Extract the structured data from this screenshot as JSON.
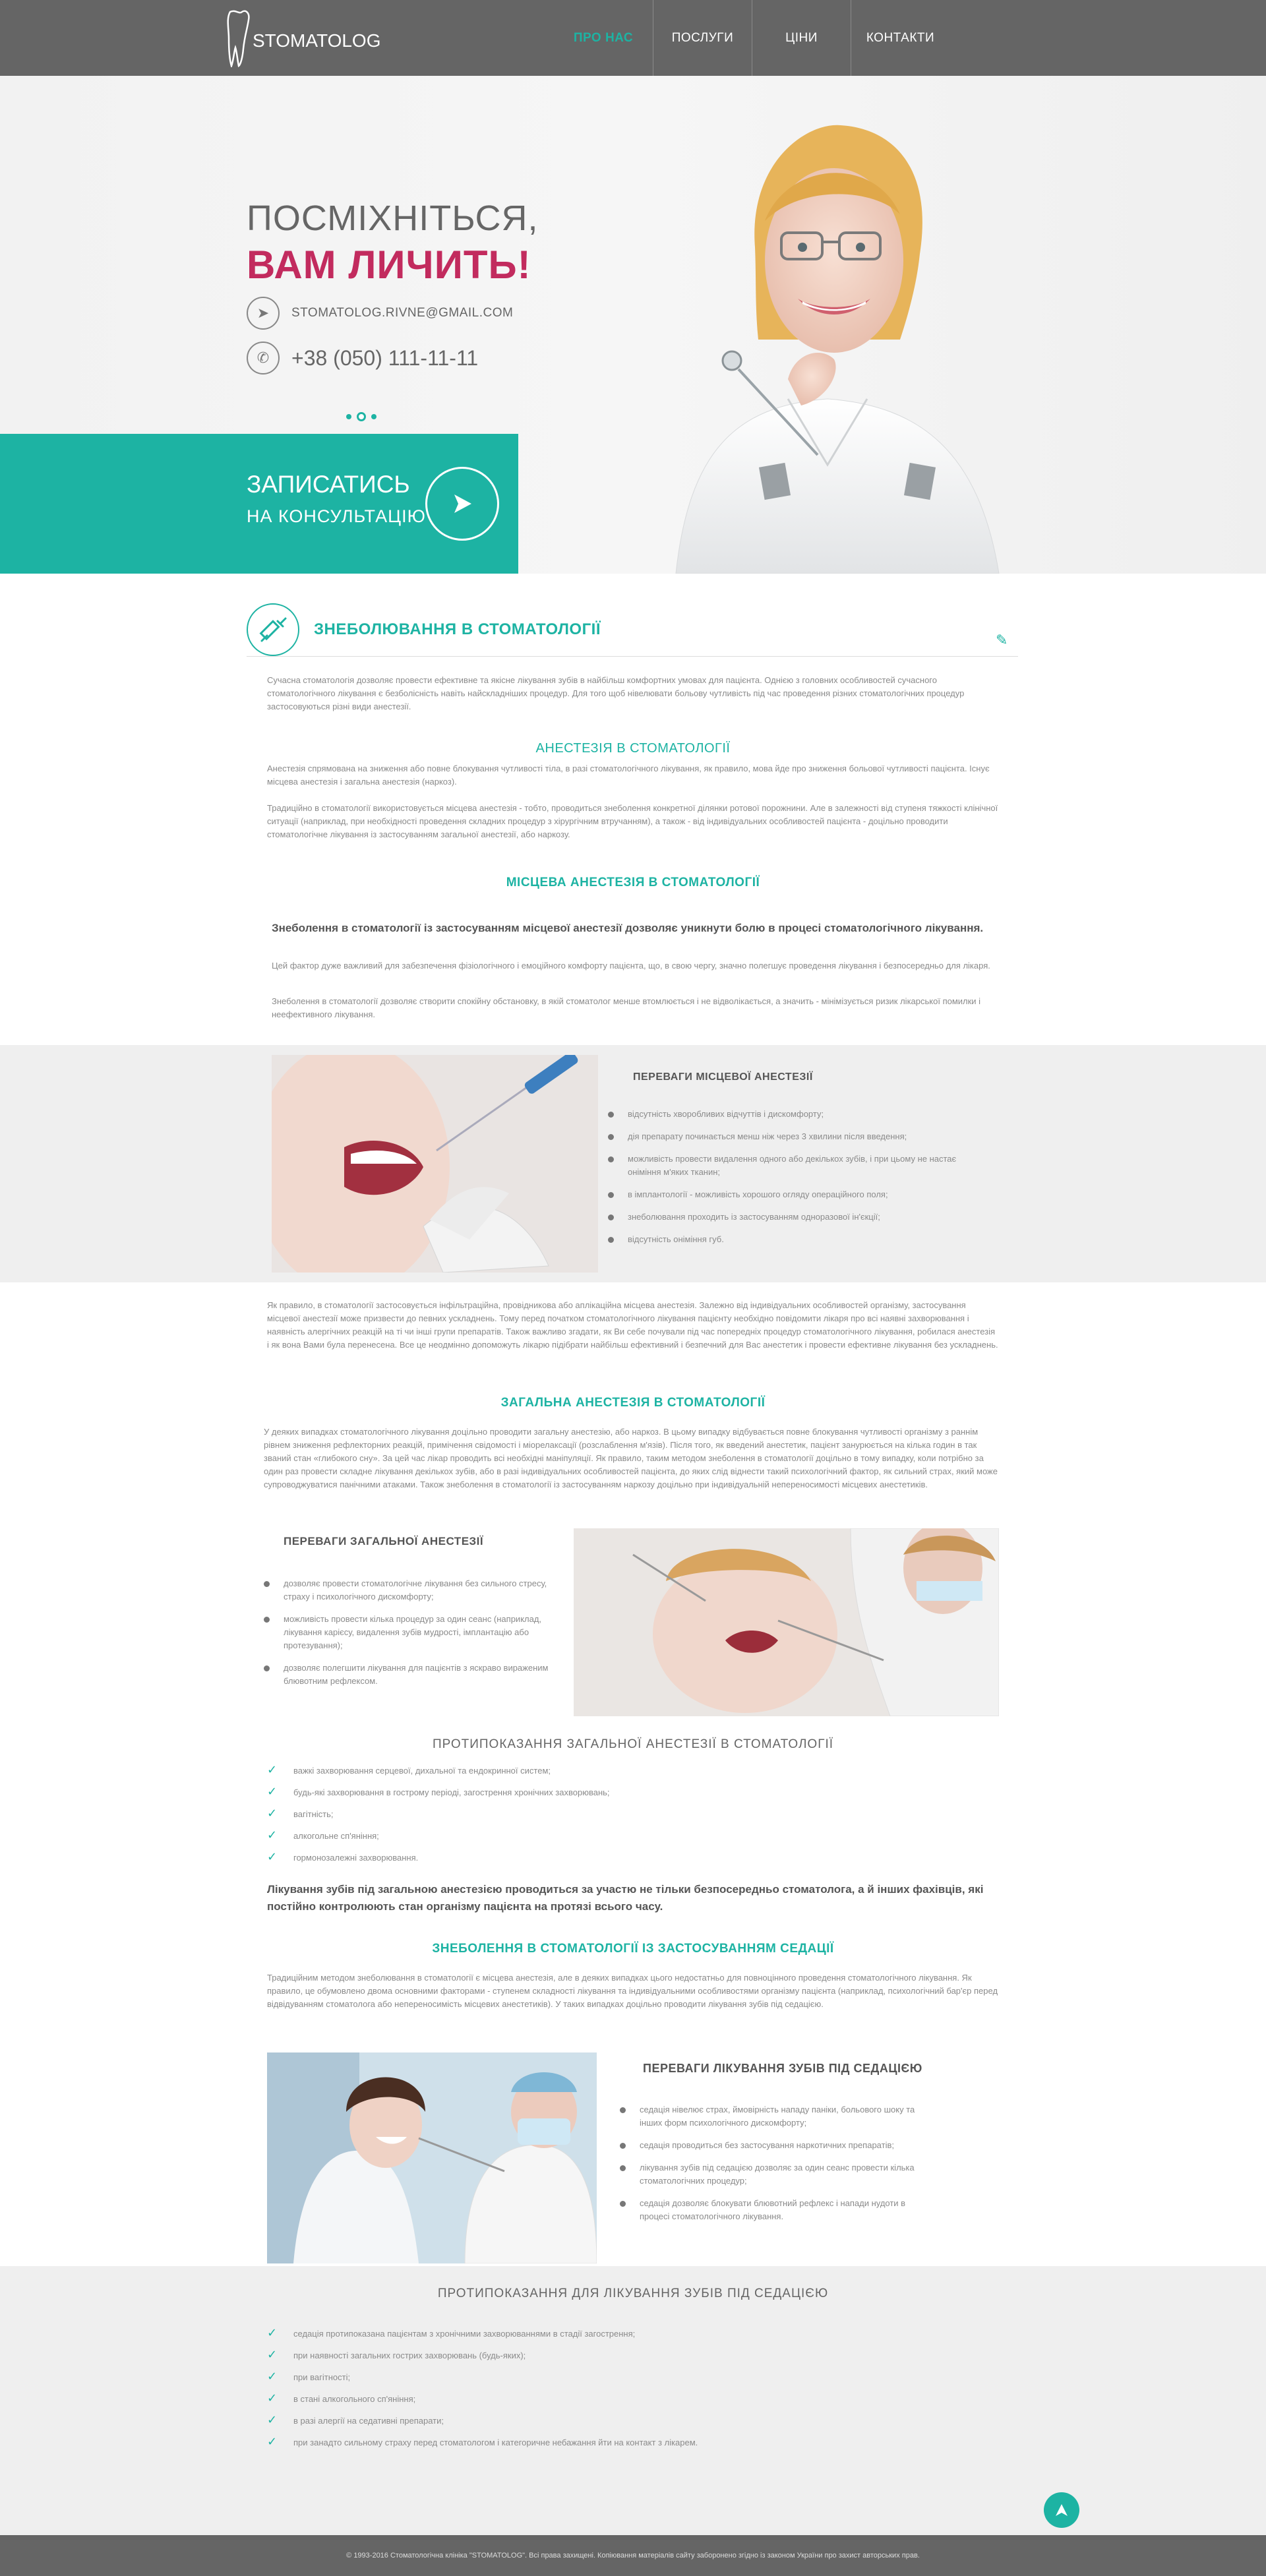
{
  "brand": {
    "name": "STOMATOLOG"
  },
  "nav": [
    {
      "label": "ПРО НАС"
    },
    {
      "label": "ПОСЛУГИ"
    },
    {
      "label": "ЦІНИ"
    },
    {
      "label": "КОНТАКТИ"
    }
  ],
  "hero": {
    "title1": "ПОСМІХНІТЬСЯ,",
    "title2": "ВАМ ЛИЧИТЬ!",
    "email": "STOMATOLOG.RIVNE@GMAIL.COM",
    "phone": "+38 (050) 111-11-11",
    "cta_line1": "ЗАПИСАТИСЬ",
    "cta_line2": "НА КОНСУЛЬТАЦІЮ",
    "slides": 3,
    "active_slide": 2
  },
  "section1": {
    "title": "ЗНЕБОЛЮВАННЯ В СТОМАТОЛОГІЇ",
    "intro": "Сучасна стоматологія дозволяє провести ефективне та якісне лікування зубів в найбільш комфортних умовах для пацієнта. Однією з головних особливостей сучасного стоматологічного лікування є безболісність навіть найскладніших процедур. Для того щоб нівелювати больову чутливість під час проведення різних стоматологічних процедур застосовуються різні види анестезії.",
    "h_anest": "АНЕСТЕЗІЯ В СТОМАТОЛОГІЇ",
    "anest_p1": "Анестезія спрямована на зниження або повне блокування чутливості тіла, в разі стоматологічного лікування, як правило, мова йде про зниження больової чутливості пацієнта. Існує місцева анестезія і загальна анестезія (наркоз).",
    "anest_p2": "Традиційно в стоматології використовується місцева анестезія - тобто, проводиться знеболення конкретної ділянки ротової порожнини. Але в залежності від ступеня тяжкості клінічної ситуації (наприклад, при необхідності проведення складних процедур з хірургічним втручанням), а також - від індивідуальних особливостей пацієнта - доцільно проводити стоматологічне лікування із застосуванням загальної анестезії, або наркозу.",
    "h_local": "МІСЦЕВА АНЕСТЕЗІЯ В СТОМАТОЛОГІЇ",
    "local_lead": "Знеболення в стоматології із застосуванням місцевої анестезії дозволяє уникнути болю в процесі стоматологічного лікування.",
    "local_p1": "Цей фактор дуже важливий для забезпечення фізіологічного і емоційного комфорту пацієнта, що, в свою чергу, значно полегшує проведення лікування і безпосередньо для лікаря.",
    "local_p2": "Знеболення в стоматології дозволяє створити спокійну обстановку, в якій стоматолог менше втомлюється і не відволікається, а значить - мінімізується ризик лікарської помилки і неефективного лікування."
  },
  "local_benefits": {
    "title": "ПЕРЕВАГИ МІСЦЕВОЇ АНЕСТЕЗІЇ",
    "items": [
      "відсутність хворобливих відчуттів і дискомфорту;",
      "дія препарату починається менш ніж через 3 хвилини після введення;",
      "можливість провести видалення одного або декількох зубів, і при цьому не настає оніміння м'яких тканин;",
      "в імплантології - можливість хорошого огляду операційного поля;",
      "знеболювання проходить із застосуванням одноразової ін'єкції;",
      "відсутність оніміння губ."
    ]
  },
  "section2": {
    "p_infiltr": "Як правило, в стоматології застосовується інфільтраційна, провідникова або аплікаційна місцева анестезія. Залежно від індивідуальних особливостей організму, застосування місцевої анестезії може призвести до певних ускладнень. Тому перед початком стоматологічного лікування пацієнту необхідно повідомити лікаря про всі наявні захворювання і наявність алергічних реакцій на ті чи інші групи препаратів. Також важливо згадати, як Ви себе почували під час попередніх процедур стоматологічного лікування, робилася анестезія і як вона Вами була перенесена. Все це неодмінно допоможуть лікарю підібрати найбільш ефективний і безпечний для Вас анестетик і провести ефективне лікування без ускладнень.",
    "h_general": "ЗАГАЛЬНА АНЕСТЕЗІЯ В СТОМАТОЛОГІЇ",
    "p_general": "У деяких випадках стоматологічного лікування доцільно проводити загальну анестезію, або наркоз. В цьому випадку відбувається повне блокування чутливості організму з раннім рівнем зниження рефлекторних реакцій, примічення свідомості і міорелаксації (розслаблення м'язів). Після того, як введений анестетик, пацієнт занурюється на кілька годин в так званий стан «глибокого сну». За цей час лікар проводить всі необхідні маніпуляції. Як правило, таким методом знеболення в стоматології доцільно в тому випадку, коли потрібно за один раз провести складне лікування декількох зубів, або в разі індивідуальних особливостей пацієнта, до яких слід віднести такий психологічний фактор, як сильний страх, який може супроводжуватися панічними атаками. Також знеболення в стоматології із застосуванням наркозу доцільно при індивідуальній непереносимості місцевих анестетиків."
  },
  "general_benefits": {
    "title": "ПЕРЕВАГИ ЗАГАЛЬНОЇ АНЕСТЕЗІЇ",
    "items": [
      "дозволяє провести стоматологічне лікування без сильного стресу, страху і психологічного дискомфорту;",
      "можливість провести кілька процедур за один сеанс (наприклад, лікування карієсу, видалення зубів мудрості, імплантацію або протезування);",
      "дозволяє полегшити лікування для пацієнтів з яскраво вираженим блювотним рефлексом."
    ]
  },
  "contra_general": {
    "title": "ПРОТИПОКАЗАННЯ ЗАГАЛЬНОЇ АНЕСТЕЗІЇ В СТОМАТОЛОГІЇ",
    "items": [
      "важкі захворювання серцевої, дихальної та ендокринної систем;",
      "будь-які захворювання в гострому періоді, загострення хронічних захворювань;",
      "вагітність;",
      "алкогольне сп'яніння;",
      "гормонозалежні захворювання."
    ],
    "lead": "Лікування зубів під загальною анестезією проводиться за участю не тільки безпосередньо стоматолога, а й інших фахівців, які постійно контролюють стан організму пацієнта на протязі всього часу."
  },
  "section3": {
    "h_sedation": "ЗНЕБОЛЕННЯ В СТОМАТОЛОГІЇ ІЗ ЗАСТОСУВАННЯМ СЕДАЦІЇ",
    "p_sedation": "Традиційним методом знеболювання в стоматології є місцева анестезія, але в деяких випадках цього недостатньо для повноцінного проведення стоматологічного лікування. Як правило, це обумовлено двома основними факторами - ступенем складності лікування та індивідуальними особливостями організму пацієнта (наприклад, психологічний бар'єр перед відвідуванням стоматолога або непереносимість місцевих анестетиків). У таких випадках доцільно проводити лікування зубів під седацією."
  },
  "sedation_benefits": {
    "title": "ПЕРЕВАГИ ЛІКУВАННЯ ЗУБІВ ПІД СЕДАЦІЄЮ",
    "items": [
      "седація нівелює страх, ймовірність нападу паніки, больового шоку та інших форм психологічного дискомфорту;",
      "седація проводиться без застосування наркотичних препаратів;",
      "лікування зубів під седацією дозволяє за один сеанс провести кілька стоматологічних процедур;",
      "седація дозволяє блокувати блювотний рефлекс і напади нудоти в процесі стоматологічного лікування."
    ]
  },
  "contra_sedation": {
    "title": "ПРОТИПОКАЗАННЯ ДЛЯ ЛІКУВАННЯ ЗУБІВ ПІД СЕДАЦІЄЮ",
    "items": [
      "седація протипоказана пацієнтам з хронічними захворюваннями в стадії загострення;",
      "при наявності загальних гострих захворювань (будь-яких);",
      "при вагітності;",
      "в стані алкогольного сп'яніння;",
      "в разі алергії на седативні препарати;",
      "при занадто сильному страху перед стоматологом і категоричне небажання йти на контакт з лікарем."
    ]
  },
  "footer": {
    "copyright": "© 1993-2016 Стоматологічна клініка \"STOMATOLOG\". Всі права захищені. Копіювання матеріалів сайту заборонено згідно із законом України про захист авторських прав."
  },
  "colors": {
    "accent": "#1db3a3",
    "brand_red": "#c22b5e",
    "header": "#656565"
  }
}
